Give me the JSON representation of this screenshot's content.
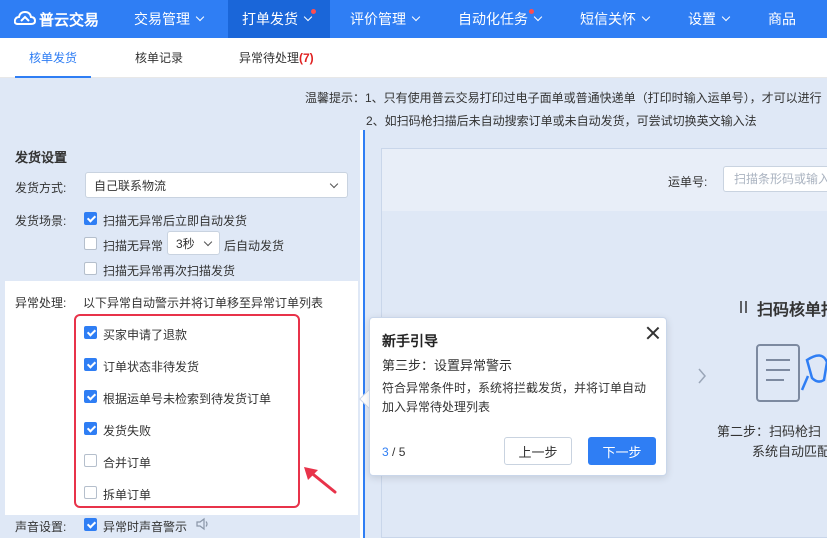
{
  "app": {
    "logo_text": "普云交易"
  },
  "nav": {
    "items": [
      {
        "label": "交易管理"
      },
      {
        "label": "打单发货"
      },
      {
        "label": "评价管理"
      },
      {
        "label": "自动化任务"
      },
      {
        "label": "短信关怀"
      },
      {
        "label": "设置"
      },
      {
        "label": "商品"
      }
    ]
  },
  "tabs": {
    "t0": "核单发货",
    "t1": "核单记录",
    "t2": "异常待处理",
    "t2_count": "(7)"
  },
  "notice": {
    "line1": "温馨提示：1、只有使用普云交易打印过电子面单或普通快递单（打印时输入运单号），才可以进行",
    "line2": "2、如扫码枪扫描后未自动搜索订单或未自动发货，可尝试切换英文输入法"
  },
  "settings": {
    "title": "发货设置",
    "method_label": "发货方式:",
    "method_value": "自己联系物流",
    "scene_label": "发货场景:",
    "scene_opt1": "扫描无异常后立即自动发货",
    "scene_opt2_a": "扫描无异常",
    "scene_opt2_delay": "3秒",
    "scene_opt2_b": "后自动发货",
    "scene_opt3": "扫描无异常再次扫描发货",
    "exception_label": "异常处理:",
    "exception_desc": "以下异常自动警示并将订单移至异常订单列表",
    "exceptions": [
      {
        "label": "买家申请了退款",
        "checked": true
      },
      {
        "label": "订单状态非待发货",
        "checked": true
      },
      {
        "label": "根据运单号未检索到待发货订单",
        "checked": true
      },
      {
        "label": "发货失败",
        "checked": true
      },
      {
        "label": "合并订单",
        "checked": false
      },
      {
        "label": "拆单订单",
        "checked": false
      }
    ],
    "sound_label": "声音设置:",
    "sound_opt": "异常时声音警示"
  },
  "guide": {
    "title": "新手引导",
    "step": "第三步：设置异常警示",
    "desc": "符合异常条件时，系统将拦截发货，并将订单自动加入异常待处理列表",
    "page_current": "3",
    "page_total": " / 5",
    "prev_label": "上一步",
    "next_label": "下一步"
  },
  "scan": {
    "waybill_label": "运单号:",
    "placeholder": "扫描条形码或输入",
    "title": "扫码核单指",
    "step2_line1": "第二步：扫码枪扫",
    "step2_line2": "系统自动匹配"
  },
  "colors": {
    "brand": "#2f7ef4",
    "highlight_border": "#e8334a",
    "alert_dot": "#ff4d4f"
  }
}
